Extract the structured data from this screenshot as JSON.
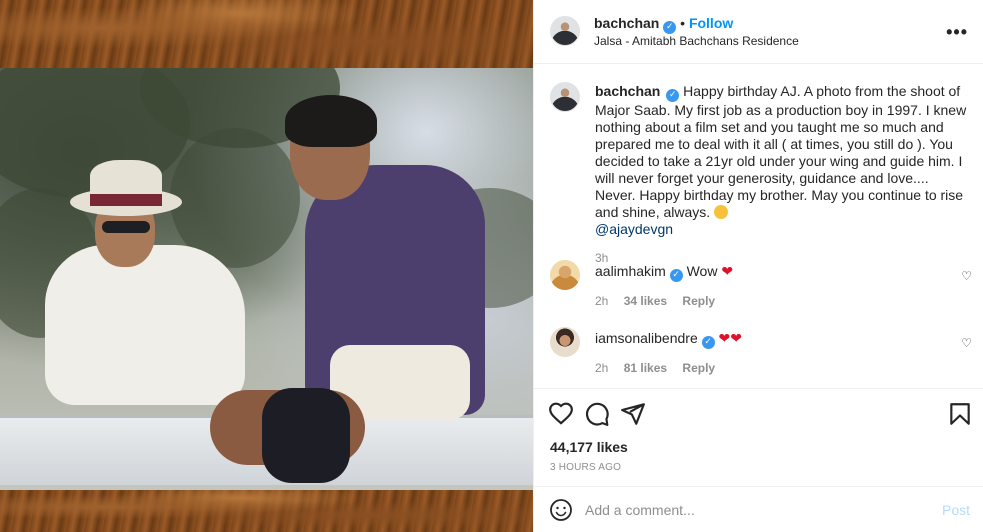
{
  "post": {
    "username": "bachchan",
    "follow_label": "Follow",
    "separator": "•",
    "location": "Jalsa - Amitabh Bachchans Residence",
    "more_label": "•••",
    "caption_text": "Happy birthday AJ. A photo from the shoot of Major Saab. My first job as a production boy in 1997. I knew nothing about a film set and you taught me so much and prepared me to deal with it all ( at times, you still do ). You decided to take a 21yr old under your wing and guide him. I will never forget your generosity, guidance and love.... Never. Happy birthday my brother. May you continue to rise and shine, always.",
    "caption_mention": "@ajaydevgn",
    "caption_time": "3h"
  },
  "comments": [
    {
      "username": "aalimhakim",
      "text": "Wow",
      "time": "2h",
      "likes": "34 likes",
      "reply": "Reply"
    },
    {
      "username": "iamsonalibendre",
      "text": "",
      "time": "2h",
      "likes": "81 likes",
      "reply": "Reply"
    }
  ],
  "actions": {
    "likes": "44,177 likes",
    "time": "3 HOURS AGO"
  },
  "add_comment": {
    "placeholder": "Add a comment...",
    "post_label": "Post"
  },
  "colors": {
    "accent": "#0095f6",
    "verified": "#3897f0",
    "heart": "#e0112b",
    "muted": "#8e8e8e"
  },
  "icons": [
    "verified-badge-icon",
    "more-icon",
    "heart-icon",
    "comment-icon",
    "share-icon",
    "bookmark-icon",
    "emoji-icon"
  ]
}
